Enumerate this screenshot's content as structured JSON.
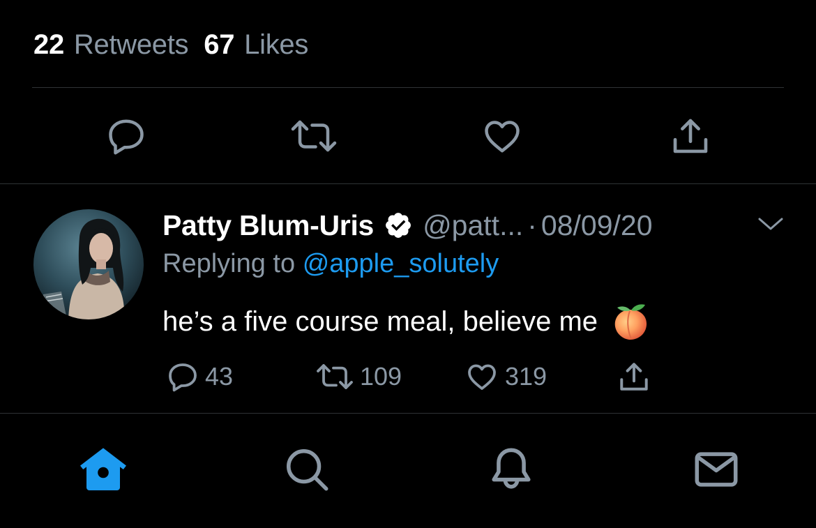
{
  "stats": {
    "retweets_count": "22",
    "retweets_label": "Retweets",
    "likes_count": "67",
    "likes_label": "Likes"
  },
  "main_actions": [
    "reply-icon",
    "retweet-icon",
    "like-icon",
    "share-icon"
  ],
  "reply_tweet": {
    "author_name": "Patty Blum-Uris",
    "verified": true,
    "handle": "@patt...",
    "separator": "·",
    "date": "08/09/20",
    "replying_to_prefix": "Replying to",
    "replying_to_handle": "@apple_solutely",
    "text": "he’s a five course meal, believe me",
    "emoji": "peach",
    "reply_count": "43",
    "retweet_count": "109",
    "like_count": "319"
  },
  "tab_bar": {
    "items": [
      "home-icon",
      "search-icon",
      "notifications-icon",
      "messages-icon"
    ],
    "active": "home-icon"
  },
  "colors": {
    "background": "#000000",
    "text_primary": "#ffffff",
    "text_secondary": "#8b98a5",
    "accent": "#1d9bf0",
    "divider": "#2f3336"
  }
}
